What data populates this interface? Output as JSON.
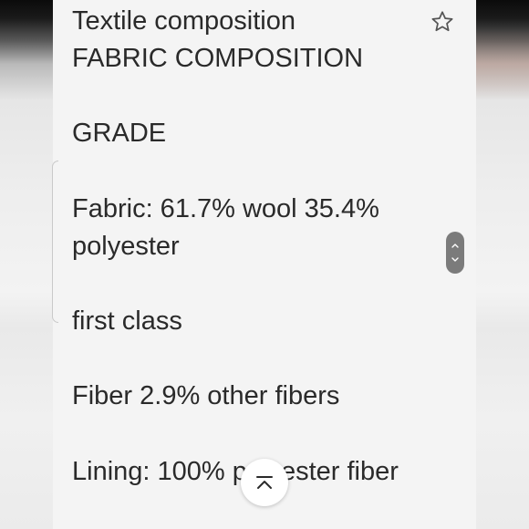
{
  "text_lines": [
    "Textile composition",
    "FABRIC COMPOSITION",
    "GRADE",
    "Fabric: 61.7% wool 35.4%",
    "polyester",
    "first class",
    "Fiber 2.9% other fibers",
    "Lining: 100% polyester fiber"
  ],
  "icons": {
    "favorite": "star-outline-icon",
    "scroll_up": "chevron-up-icon",
    "scroll_down": "chevron-down-icon",
    "back_to_top": "caret-up-icon"
  },
  "colors": {
    "text": "#2a2a2a",
    "page_background": "#f4f4f4",
    "scroll_handle": "#7b7b7b",
    "icon": "#555555"
  }
}
